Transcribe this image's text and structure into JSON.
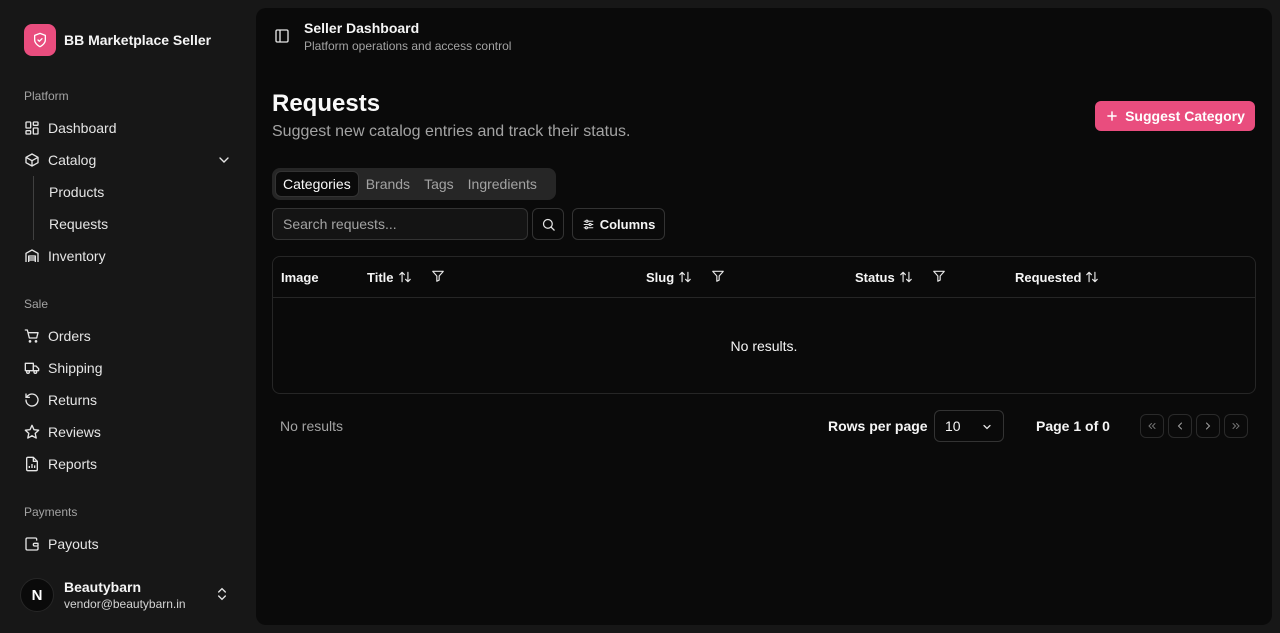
{
  "brand": {
    "name": "BB Marketplace Seller",
    "logo_icon": "shield-check-icon",
    "accent": "#e94d7e"
  },
  "sidebar": {
    "sections": {
      "platform": "Platform",
      "sale": "Sale",
      "payments": "Payments"
    },
    "items": {
      "dashboard": "Dashboard",
      "catalog": "Catalog",
      "products": "Products",
      "requests": "Requests",
      "inventory": "Inventory",
      "orders": "Orders",
      "shipping": "Shipping",
      "returns": "Returns",
      "reviews": "Reviews",
      "reports": "Reports",
      "payouts": "Payouts"
    }
  },
  "user": {
    "initial": "N",
    "name": "Beautybarn",
    "email": "vendor@beautybarn.in"
  },
  "header": {
    "title": "Seller Dashboard",
    "subtitle": "Platform operations and access control"
  },
  "page": {
    "title": "Requests",
    "subtitle": "Suggest new catalog entries and track their status.",
    "suggest_label": "Suggest Category"
  },
  "tabs": [
    "Categories",
    "Brands",
    "Tags",
    "Ingredients"
  ],
  "search": {
    "placeholder": "Search requests..."
  },
  "columns_label": "Columns",
  "table": {
    "headers": {
      "image": "Image",
      "title": "Title",
      "slug": "Slug",
      "status": "Status",
      "requested": "Requested"
    },
    "empty": "No results."
  },
  "footer": {
    "count": "No results",
    "rows_per_page_label": "Rows per page",
    "rows_per_page": "10",
    "page_info": "Page 1 of 0"
  }
}
